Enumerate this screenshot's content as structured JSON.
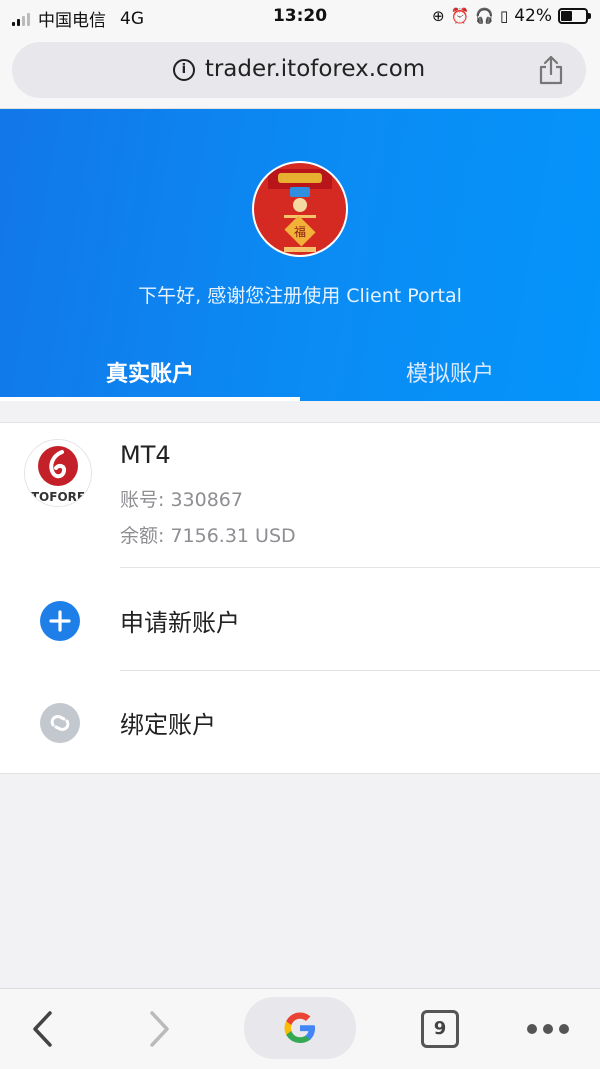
{
  "status_bar": {
    "carrier": "中国电信",
    "network": "4G",
    "time": "13:20",
    "battery": "42%"
  },
  "browser": {
    "url": "trader.itoforex.com",
    "tab_count": "9"
  },
  "header": {
    "greeting": "下午好, 感谢您注册使用 Client Portal",
    "tabs": [
      {
        "label": "真实账户",
        "active": true
      },
      {
        "label": "模拟账户",
        "active": false
      }
    ]
  },
  "account": {
    "name": "MT4",
    "number": "账号: 330867",
    "balance": "余额: 7156.31 USD",
    "logo_text": "TOFORE"
  },
  "actions": {
    "new_account": "申请新账户",
    "bind_account": "绑定账户"
  },
  "colors": {
    "header_blue": "#0a8cf4",
    "accent_blue": "#1f7fe8"
  }
}
